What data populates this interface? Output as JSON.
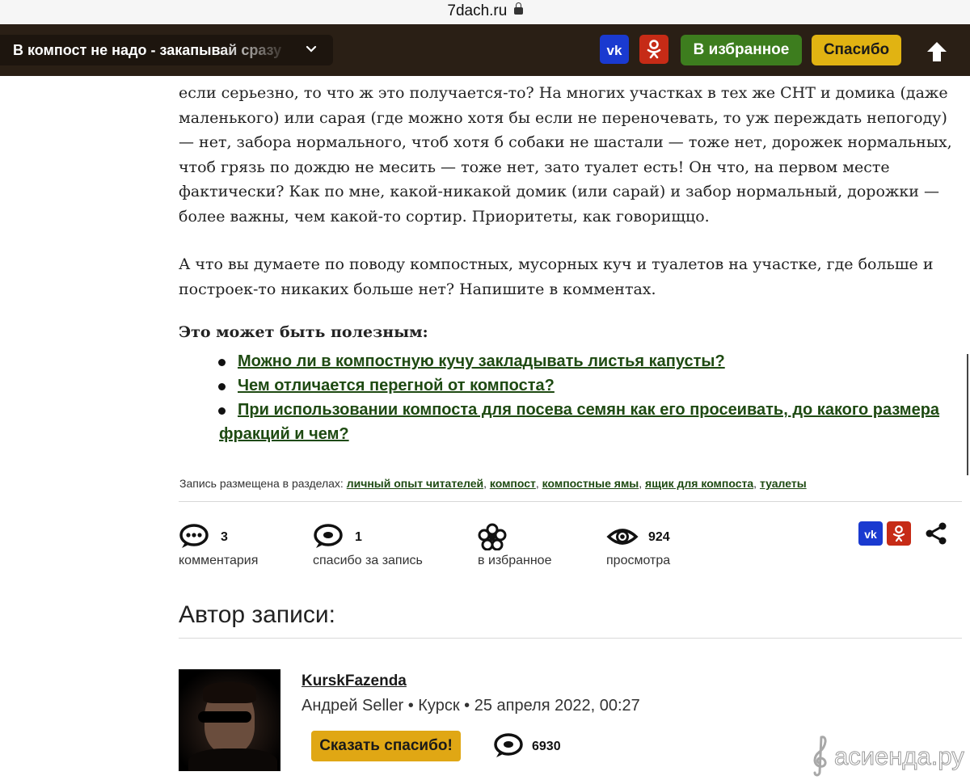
{
  "browser": {
    "domain": "7dach.ru"
  },
  "topbar": {
    "title": "В компост не надо - закапывай сразу",
    "vk_label": "VK",
    "ok_label": "OK",
    "favorite_label": "В избранное",
    "thanks_label": "Спасибо"
  },
  "article": {
    "paragraph1": "если серьезно, то что ж это получается-то? На многих участках в тех же СНТ и домика (даже маленького) или сарая (где можно хотя бы если не переночевать, то уж переждать непогоду) — нет, забора нормального, чтоб хотя б собаки не шастали — тоже нет, дорожек нормальных, чтоб грязь по дождю не месить — тоже нет, зато туалет есть! Он что, на первом месте фактически? Как по мне, какой-никакой домик (или сарай) и забор нормальный, дорожки — более важны, чем какой-то сортир. Приоритеты, как говорищцо.",
    "paragraph2": "А что вы думаете по поводу компостных, мусорных куч и туалетов на участке, где больше и построек-то никаких больше нет? Напишите в комментах.",
    "useful_heading": "Это может быть полезным:",
    "useful_links": [
      "Можно ли в компостную кучу закладывать листья капусты?",
      "Чем отличается перегной от компоста?",
      "При использовании компоста для посева семян как его просеивать, до какого размера фракций и чем?"
    ],
    "sections_prefix": "Запись размещена в разделах:",
    "sections": [
      "личный опыт читателей",
      "компост",
      "компостные ямы",
      "ящик для компоста",
      "туалеты"
    ]
  },
  "stats": {
    "comments_count": "3",
    "comments_label": "комментария",
    "thanks_count": "1",
    "thanks_label": "спасибо за запись",
    "favorites_label": "в избранное",
    "views_count": "924",
    "views_label": "просмотра"
  },
  "author": {
    "heading": "Автор записи:",
    "username": "KurskFazenda",
    "meta": "Андрей Seller • Курск • 25 апреля 2022, 00:27",
    "thanks_button": "Сказать спасибо!",
    "comments_count": "6930"
  },
  "watermark": {
    "text": "асиенда.ру"
  },
  "colors": {
    "topbar_bg": "#2a1f15",
    "favorite_green": "#3d7d1e",
    "thanks_yellow": "#e1b312",
    "vk_blue": "#1a3ad0",
    "ok_red": "#c62b16",
    "link_green": "#1e4a12"
  },
  "icons": [
    "lock-icon",
    "chevron-down-icon",
    "vk-icon",
    "ok-icon",
    "arrow-up-icon",
    "comment-icon",
    "chat-bubble-icon",
    "flower-icon",
    "eye-icon",
    "share-icon"
  ]
}
